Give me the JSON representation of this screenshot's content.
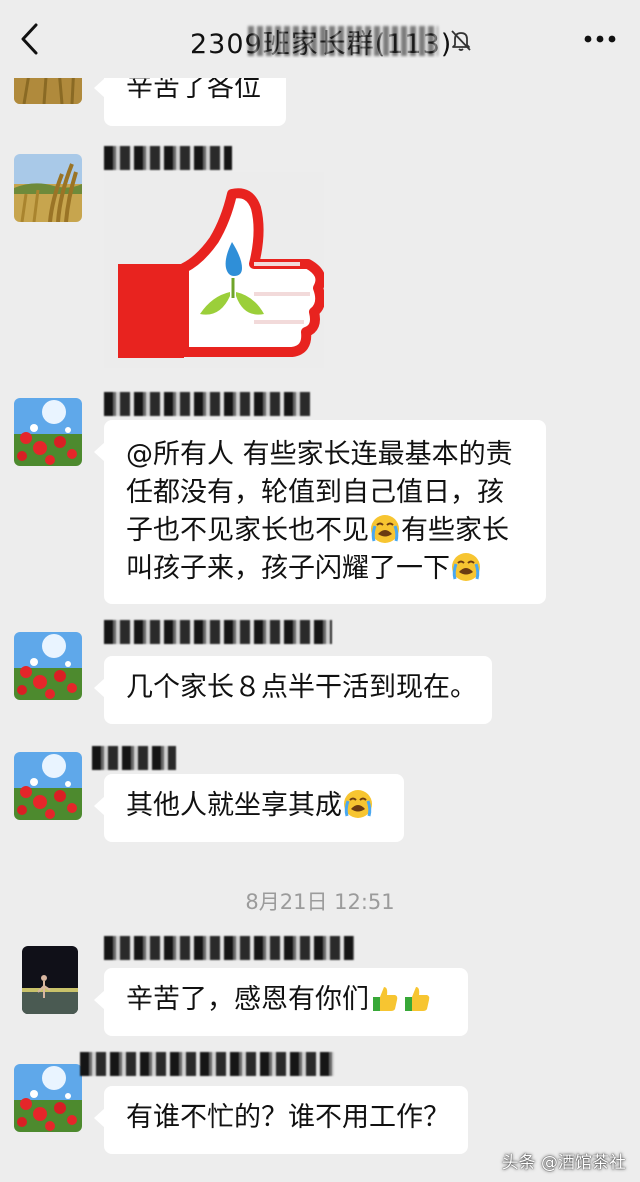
{
  "header": {
    "title": "2309班家长群(113)",
    "back_icon": "chevron-left-icon",
    "mute_icon": "bell-off-icon",
    "more_icon": "more-dots-icon"
  },
  "messages": [
    {
      "text_lines": [
        "辛苦了各位"
      ]
    },
    {
      "sticker_icon": "thumbs-up-sticker"
    },
    {
      "text_lines": [
        "@所有人 有些家长连最基本的责",
        "任都没有，轮值到自己值日，孩",
        "子也不见家长也不见",
        "有些家长",
        "叫孩子来，孩子闪耀了一下"
      ]
    },
    {
      "text_lines": [
        "几个家长８点半干活到现在。"
      ]
    },
    {
      "text_lines": [
        "其他人就坐享其成"
      ]
    },
    {
      "text_lines": [
        "辛苦了，感恩有你们"
      ]
    },
    {
      "text_lines": [
        "有谁不忙的？谁不用工作？"
      ]
    }
  ],
  "timestamp": "8月21日 12:51",
  "watermark": "头条 @酒馆茶社",
  "colors": {
    "background": "#ededed",
    "bubble": "#ffffff",
    "timestamp": "#9b9b9b",
    "thumb_red": "#e8231f"
  }
}
